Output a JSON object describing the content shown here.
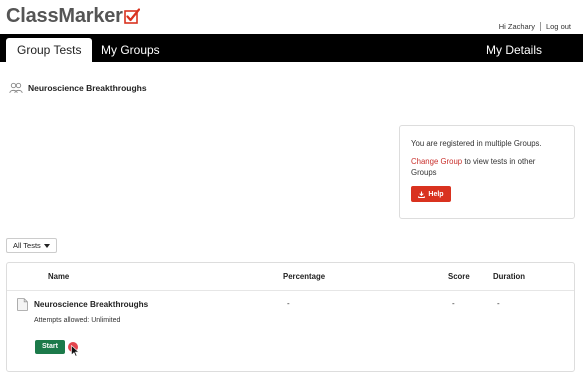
{
  "brand": {
    "name": "ClassMarker",
    "check_color": "#d9321f"
  },
  "user_links": {
    "greeting": "Hi Zachary",
    "logout": "Log out"
  },
  "nav": {
    "tabs": [
      {
        "label": "Group Tests",
        "active": true
      },
      {
        "label": "My Groups",
        "active": false
      }
    ],
    "right_tab": "My Details"
  },
  "group": {
    "name": "Neuroscience Breakthroughs",
    "icon": "users-icon"
  },
  "info_box": {
    "line1": "You are registered in multiple Groups.",
    "change_group_link": "Change Group",
    "line2_rest": " to view tests in other Groups",
    "help_label": "Help",
    "help_icon": "download-icon"
  },
  "filter": {
    "selected": "All Tests"
  },
  "table": {
    "headers": {
      "name": "Name",
      "percentage": "Percentage",
      "score": "Score",
      "duration": "Duration"
    },
    "rows": [
      {
        "name": "Neuroscience Breakthroughs",
        "attempts": "Attempts allowed: Unlimited",
        "percentage": "-",
        "score": "-",
        "duration": "-",
        "start_label": "Start"
      }
    ]
  },
  "colors": {
    "navbar": "#000000",
    "accent_red": "#d9321f",
    "start_green": "#1c7a4a"
  }
}
